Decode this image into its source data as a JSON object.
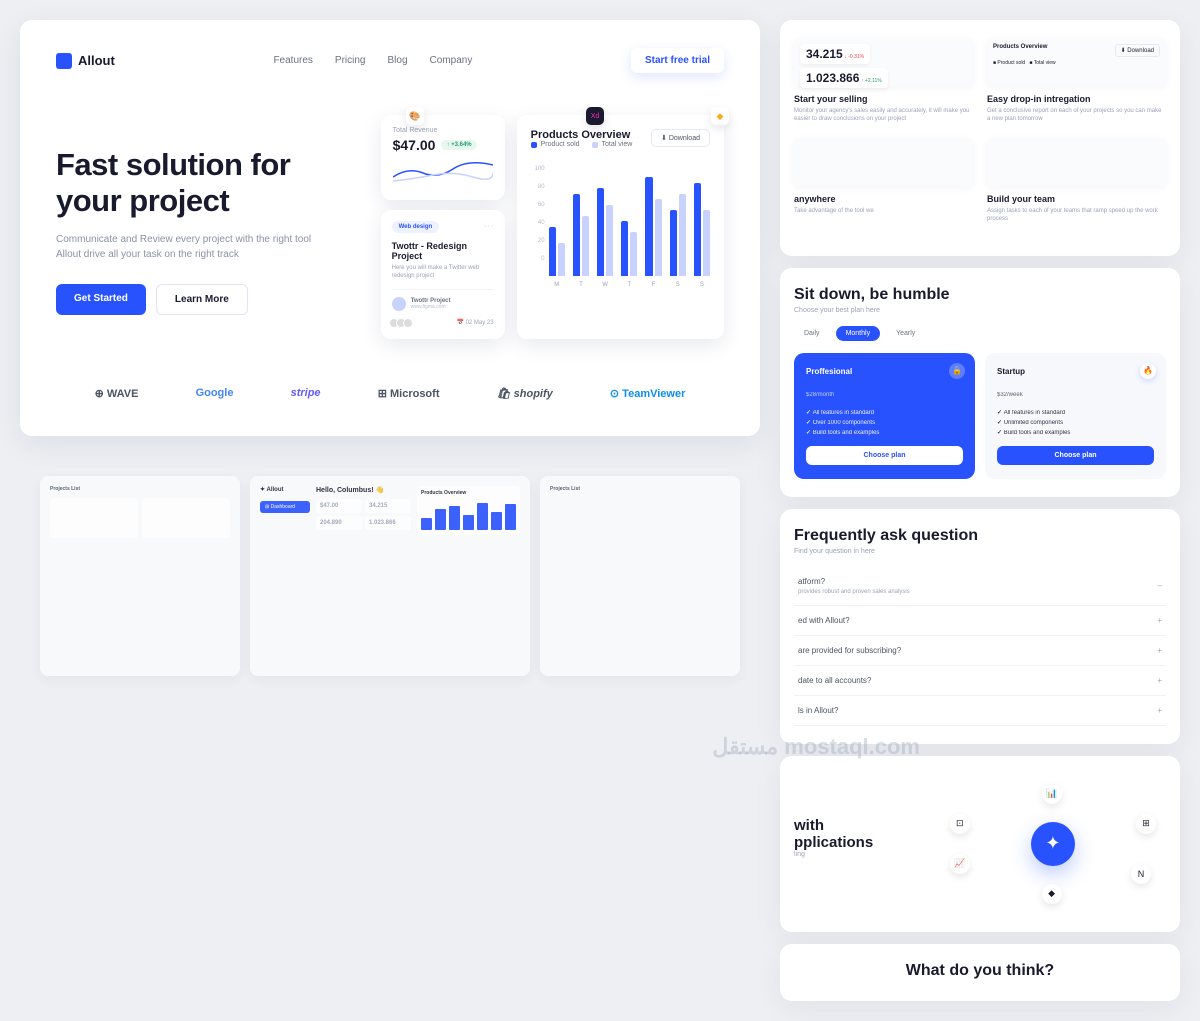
{
  "brand": "Allout",
  "nav": [
    "Features",
    "Pricing",
    "Blog",
    "Company"
  ],
  "cta": "Start free trial",
  "hero": {
    "title": "Fast solution for your project",
    "sub": "Communicate and Review every project with the right tool Allout drive all your task on the right track",
    "primary": "Get Started",
    "secondary": "Learn More"
  },
  "revenue": {
    "label": "Total Revenue",
    "value": "$47.00",
    "delta": "↑ +3.64%"
  },
  "project": {
    "tag": "Web design",
    "title": "Twottr - Redesign Project",
    "desc": "Here you will make a Twitter web redesign project",
    "owner": "Twottr Project",
    "owner_sub": "www.figma.com",
    "date": "📅 02 May 23"
  },
  "chart": {
    "title": "Products Overview",
    "download": "⬇ Download",
    "leg1": "Product sold",
    "leg2": "Total view"
  },
  "chart_data": {
    "type": "bar",
    "categories": [
      "M",
      "T",
      "W",
      "T",
      "F",
      "S",
      "S"
    ],
    "series": [
      {
        "name": "Product sold",
        "values": [
          45,
          75,
          80,
          50,
          90,
          60,
          85
        ]
      },
      {
        "name": "Total view",
        "values": [
          30,
          55,
          65,
          40,
          70,
          75,
          60
        ]
      }
    ],
    "ylim": [
      0,
      100
    ],
    "yticks": [
      100,
      80,
      60,
      40,
      20,
      0
    ]
  },
  "logos": [
    "⊕ WAVE",
    "Google",
    "stripe",
    "⊞ Microsoft",
    "🛍 shopify",
    "⊙ TeamViewer"
  ],
  "features": [
    {
      "title": "Start your selling",
      "desc": "Monitor your agency's sales easily and accurately, it will make you easier to draw conclusions on your project",
      "stat1": "34.215",
      "d1": "↓ -0.31%",
      "stat2": "1.023.866",
      "d2": "↑ +2.11%"
    },
    {
      "title": "Easy drop-in intregation",
      "desc": "Get a conclusive report on each of your projects so you can make a new plan tomorrow",
      "head": "Products Overview",
      "btn": "⬇ Download"
    },
    {
      "title": "anywhere",
      "desc": "Take advantage of the tool we"
    },
    {
      "title": "Build your team",
      "desc": "Assign tasks to each of your teams that ramp speed up the work process"
    }
  ],
  "pricing": {
    "heading": "Sit down, be humble",
    "sub": "Choose your best plan here",
    "tabs": [
      "Daily",
      "Monthly",
      "Yearly"
    ],
    "plans": [
      {
        "name": "Proffesional",
        "price": "$28",
        "per": "/month",
        "f": [
          "All features in standard",
          "Over 1000 components",
          "Build tools and examples"
        ],
        "btn": "Choose plan"
      },
      {
        "name": "Startup",
        "price": "$32",
        "per": "/week",
        "f": [
          "All features in standard",
          "Unlimited components",
          "Build tools and examples"
        ],
        "btn": "Choose plan"
      }
    ]
  },
  "faq": {
    "heading": "Frequently ask question",
    "sub": "Find your question in here",
    "items": [
      {
        "q": "atform?",
        "a": "provides robust and proven sales analysis",
        "open": true
      },
      {
        "q": "ed with Allout?"
      },
      {
        "q": "are provided for subscribing?"
      },
      {
        "q": "date to all accounts?"
      },
      {
        "q": "ls in Allout?"
      }
    ]
  },
  "integrate": {
    "h1": "with",
    "h2": "pplications",
    "sub": "ling"
  },
  "think": "What do you think?",
  "dash": {
    "hello": "Hello, Columbus! 👋",
    "stats": [
      "$47.00",
      "34.215",
      "204.890",
      "1.023.866"
    ],
    "project_list": "Projects List"
  },
  "watermark": "مستقل\nmostaql.com"
}
